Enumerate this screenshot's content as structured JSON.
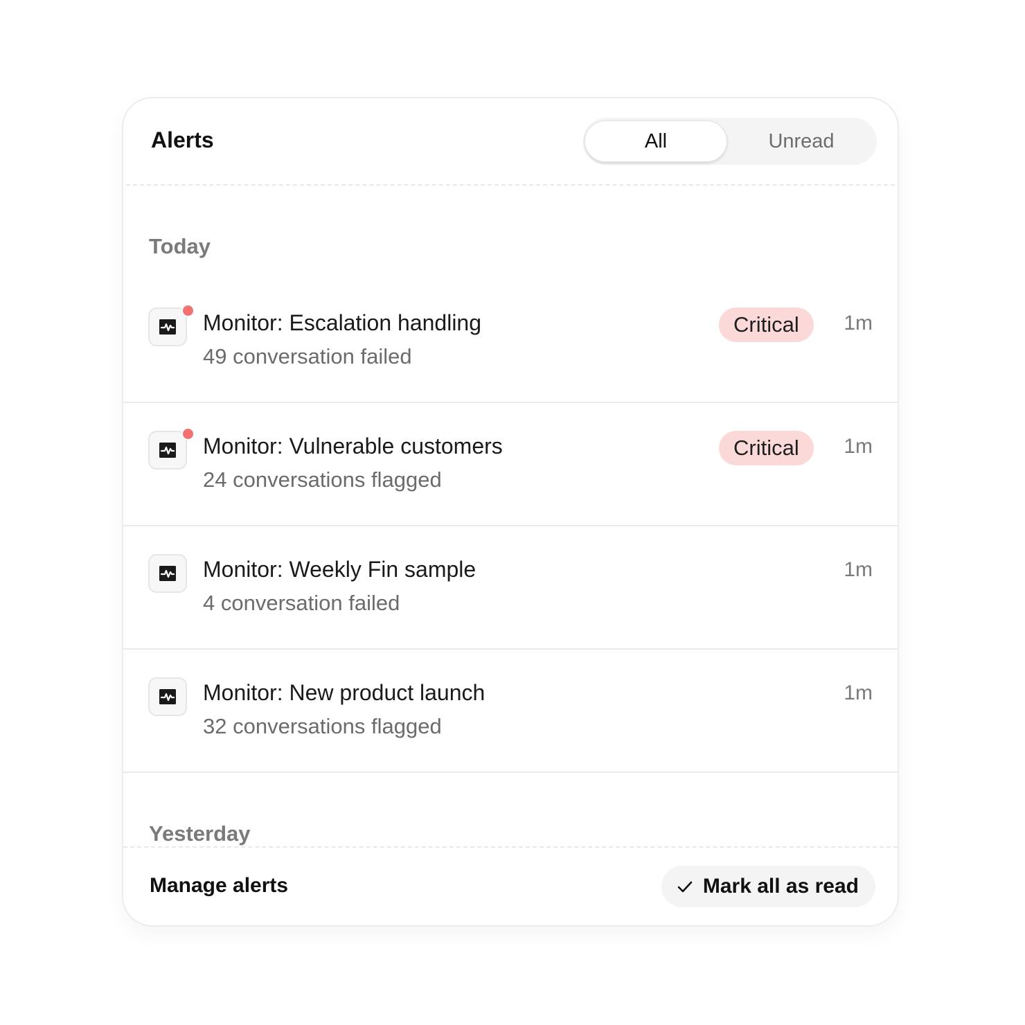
{
  "header": {
    "title": "Alerts",
    "filter_tabs": [
      {
        "label": "All",
        "active": true
      },
      {
        "label": "Unread",
        "active": false
      }
    ]
  },
  "sections": {
    "today_label": "Today",
    "yesterday_label": "Yesterday"
  },
  "alerts": [
    {
      "icon": "monitor-pulse-icon",
      "title": "Monitor: Escalation handling",
      "subtitle": "49 conversation failed",
      "badge": "Critical",
      "time": "1m",
      "unread": true
    },
    {
      "icon": "monitor-pulse-icon",
      "title": "Monitor: Vulnerable customers",
      "subtitle": "24 conversations flagged",
      "badge": "Critical",
      "time": "1m",
      "unread": true
    },
    {
      "icon": "monitor-pulse-icon",
      "title": "Monitor: Weekly Fin sample",
      "subtitle": "4 conversation failed",
      "badge": "",
      "time": "1m",
      "unread": false
    },
    {
      "icon": "monitor-pulse-icon",
      "title": "Monitor: New product launch",
      "subtitle": "32 conversations flagged",
      "badge": "",
      "time": "1m",
      "unread": false
    }
  ],
  "footer": {
    "manage_label": "Manage alerts",
    "mark_all_label": "Mark all as read",
    "mark_all_icon": "check-icon"
  },
  "colors": {
    "unread_dot": "#f27272",
    "critical_badge_bg": "#fcd9d9"
  }
}
